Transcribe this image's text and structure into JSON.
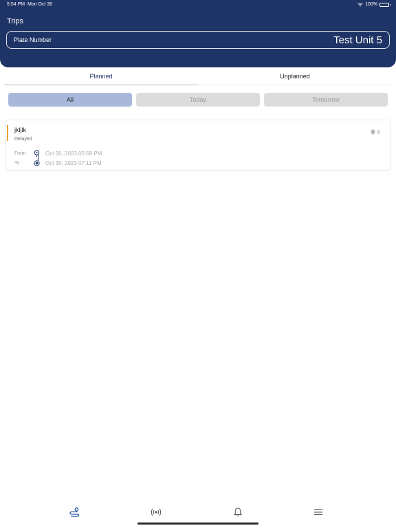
{
  "status_bar": {
    "time": "5:54 PM",
    "date": "Mon Oct 30",
    "battery": "100%"
  },
  "header": {
    "title": "Trips",
    "plate_label": "Plate Number",
    "plate_value": "Test Unit 5"
  },
  "tabs": [
    {
      "label": "Planned",
      "selected": true
    },
    {
      "label": "Unplanned",
      "selected": false
    }
  ],
  "filters": [
    {
      "label": "All",
      "selected": true
    },
    {
      "label": "Today",
      "selected": false
    },
    {
      "label": "Tomorrow",
      "selected": false
    }
  ],
  "trips": [
    {
      "name": "jkljlk",
      "status": "Delayed",
      "status_color": "#f0a030",
      "stops": "6",
      "from_label": "From",
      "from_time": "Oct 30, 2023 05:59 PM",
      "to_label": "To",
      "to_time": "Oct 30, 2023 07:11 PM"
    }
  ],
  "bottom_nav": [
    {
      "icon": "trips-route-icon",
      "active": true
    },
    {
      "icon": "signal-broadcast-icon",
      "active": false
    },
    {
      "icon": "bell-icon",
      "active": false
    },
    {
      "icon": "hamburger-menu-icon",
      "active": false
    }
  ],
  "colors": {
    "brand": "#1f3466",
    "filter_selected": "#a9b8da",
    "filter_unselected": "#dcdcdc",
    "delayed": "#f0a030",
    "nav_active": "#2f5da8"
  }
}
